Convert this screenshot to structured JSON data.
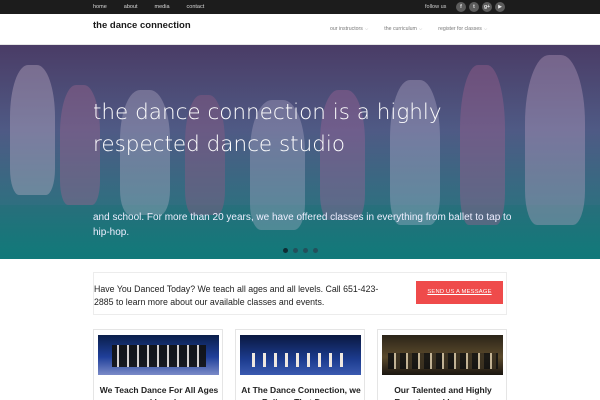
{
  "topbar": {
    "nav": [
      "home",
      "about",
      "media",
      "contact"
    ],
    "follow_label": "follow us",
    "social": [
      "facebook-icon",
      "twitter-icon",
      "google-plus-icon",
      "youtube-icon"
    ],
    "social_glyphs": [
      "f",
      "t",
      "g+",
      "▶"
    ]
  },
  "header": {
    "logo": "the dance connection",
    "nav": [
      {
        "label": "our instructors",
        "caret": "⌵"
      },
      {
        "label": "the curriculum",
        "caret": "⌵"
      },
      {
        "label": "register for classes",
        "caret": "⌵"
      }
    ]
  },
  "hero": {
    "title": "the dance connection is a highly respected dance studio",
    "subtitle": "and school. For more than 20 years, we have offered classes in everything from ballet to tap to hip-hop.",
    "slides": 4,
    "active_slide": 1
  },
  "cta": {
    "text": "Have You Danced Today? We teach all ages and all levels. Call 651-423-2885 to learn more about our available classes and events.",
    "button": "SEND US A MESSAGE",
    "button_color": "#ef4b4b"
  },
  "cards": [
    {
      "title": "We Teach Dance For All Ages and Levels"
    },
    {
      "title": "At The Dance Connection, we Believe That Dance"
    },
    {
      "title": "Our Talented and Highly Experienced Instructors"
    }
  ]
}
